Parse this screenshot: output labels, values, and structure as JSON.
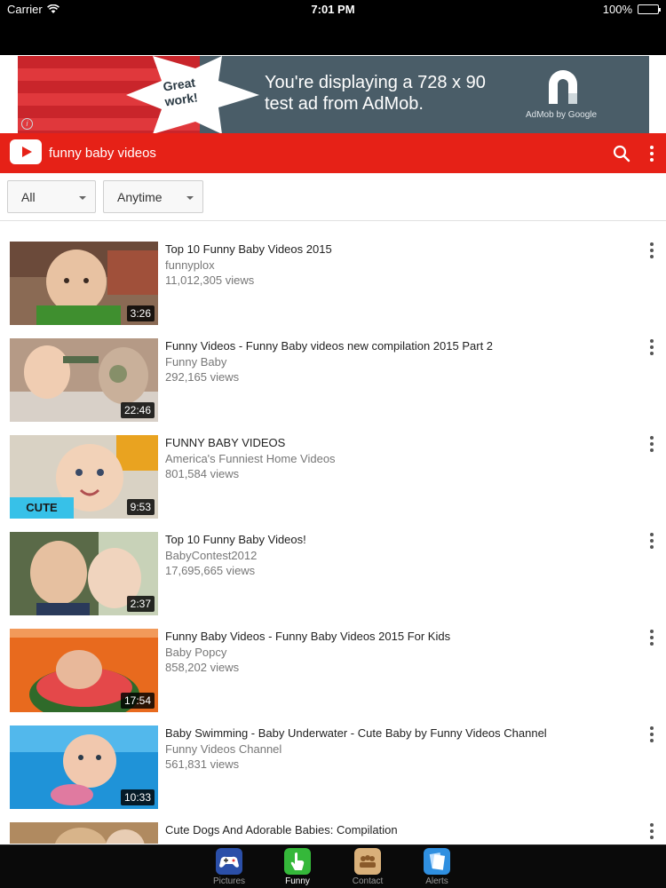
{
  "status_bar": {
    "carrier": "Carrier",
    "time": "7:01 PM",
    "battery": "100%"
  },
  "ad": {
    "badge": "Great work!",
    "message_line1": "You're displaying a 728 x 90",
    "message_line2": "test ad from AdMob.",
    "brand": "AdMob by Google",
    "info_icon": "i"
  },
  "app_bar": {
    "query": "funny baby videos"
  },
  "filters": [
    {
      "label": "All"
    },
    {
      "label": "Anytime"
    }
  ],
  "videos": [
    {
      "title": "Top 10 Funny Baby Videos 2015",
      "channel": "funnyplox",
      "views": "11,012,305 views",
      "duration": "3:26"
    },
    {
      "title": "Funny Videos - Funny Baby videos new compilation 2015 Part 2",
      "channel": "Funny Baby",
      "views": "292,165 views",
      "duration": "22:46"
    },
    {
      "title": "FUNNY BABY VIDEOS",
      "channel": "America's Funniest Home Videos",
      "views": "801,584 views",
      "duration": "9:53",
      "thumb_badge": "CUTE"
    },
    {
      "title": "Top 10 Funny Baby Videos!",
      "channel": "BabyContest2012",
      "views": "17,695,665 views",
      "duration": "2:37"
    },
    {
      "title": "Funny Baby Videos - Funny Baby Videos 2015 For Kids",
      "channel": "Baby Popcy",
      "views": "858,202 views",
      "duration": "17:54"
    },
    {
      "title": "Baby Swimming - Baby Underwater - Cute Baby by Funny Videos Channel",
      "channel": "Funny Videos Channel",
      "views": "561,831 views",
      "duration": "10:33"
    },
    {
      "title": "Cute Dogs And Adorable Babies: Compilation",
      "channel": "",
      "views": "",
      "duration": ""
    }
  ],
  "tabs": [
    {
      "label": "Pictures",
      "icon": "gamepad-icon",
      "active": false
    },
    {
      "label": "Funny",
      "icon": "hand-pointer-icon",
      "active": true
    },
    {
      "label": "Contact",
      "icon": "people-icon",
      "active": false
    },
    {
      "label": "Alerts",
      "icon": "documents-icon",
      "active": false
    }
  ],
  "colors": {
    "accent": "#e62117",
    "ad_bg": "#4a5d68",
    "ad_red": "#c9252b"
  }
}
